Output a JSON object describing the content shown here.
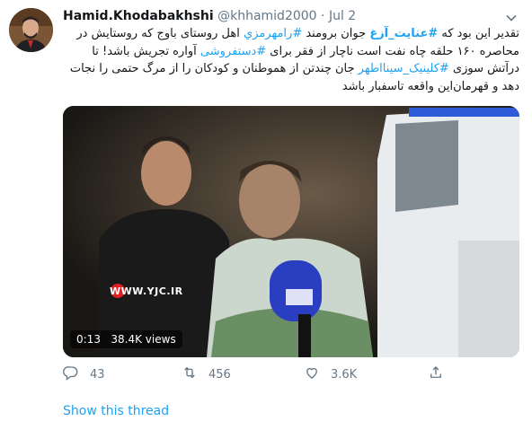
{
  "tweet": {
    "display_name": "Hamid.Khodabakhshi",
    "handle": "@khhamid2000",
    "separator": "·",
    "date": "Jul 2",
    "text_parts": [
      {
        "t": "تقدیر این بود که ",
        "type": "text"
      },
      {
        "t": "#عنایت_آزغ",
        "type": "hashtag-bold"
      },
      {
        "t": " جوان برومند ",
        "type": "text"
      },
      {
        "t": "#رامهرمزي",
        "type": "hashtag"
      },
      {
        "t": " اهل روستای باوج که روستایش در محاصره ۱۶۰ حلقه چاه نفت است ناچار از فقر برای ",
        "type": "text"
      },
      {
        "t": "#دستفروشی",
        "type": "hashtag"
      },
      {
        "t": " آواره تجریش باشد! تا درآتش سوزی ",
        "type": "text"
      },
      {
        "t": "#کلینیک_سینااطهر",
        "type": "hashtag"
      },
      {
        "t": " جان چندتن از هموطنان و کودکان را از مرگ حتمی را نجات دهد و قهرمان‌این واقعه تاسفبار باشد",
        "type": "text"
      }
    ]
  },
  "video": {
    "time": "0:13",
    "views": "38.4K views",
    "watermark": "WWW.YJC.IR"
  },
  "actions": {
    "replies": "43",
    "retweets": "456",
    "likes": "3.6K"
  },
  "show_thread": "Show this thread",
  "colors": {
    "accent": "#1da1f2",
    "muted": "#657786",
    "text": "#14171a"
  },
  "icons": [
    "chevron-down-icon",
    "reply-icon",
    "retweet-icon",
    "like-icon",
    "share-icon"
  ]
}
